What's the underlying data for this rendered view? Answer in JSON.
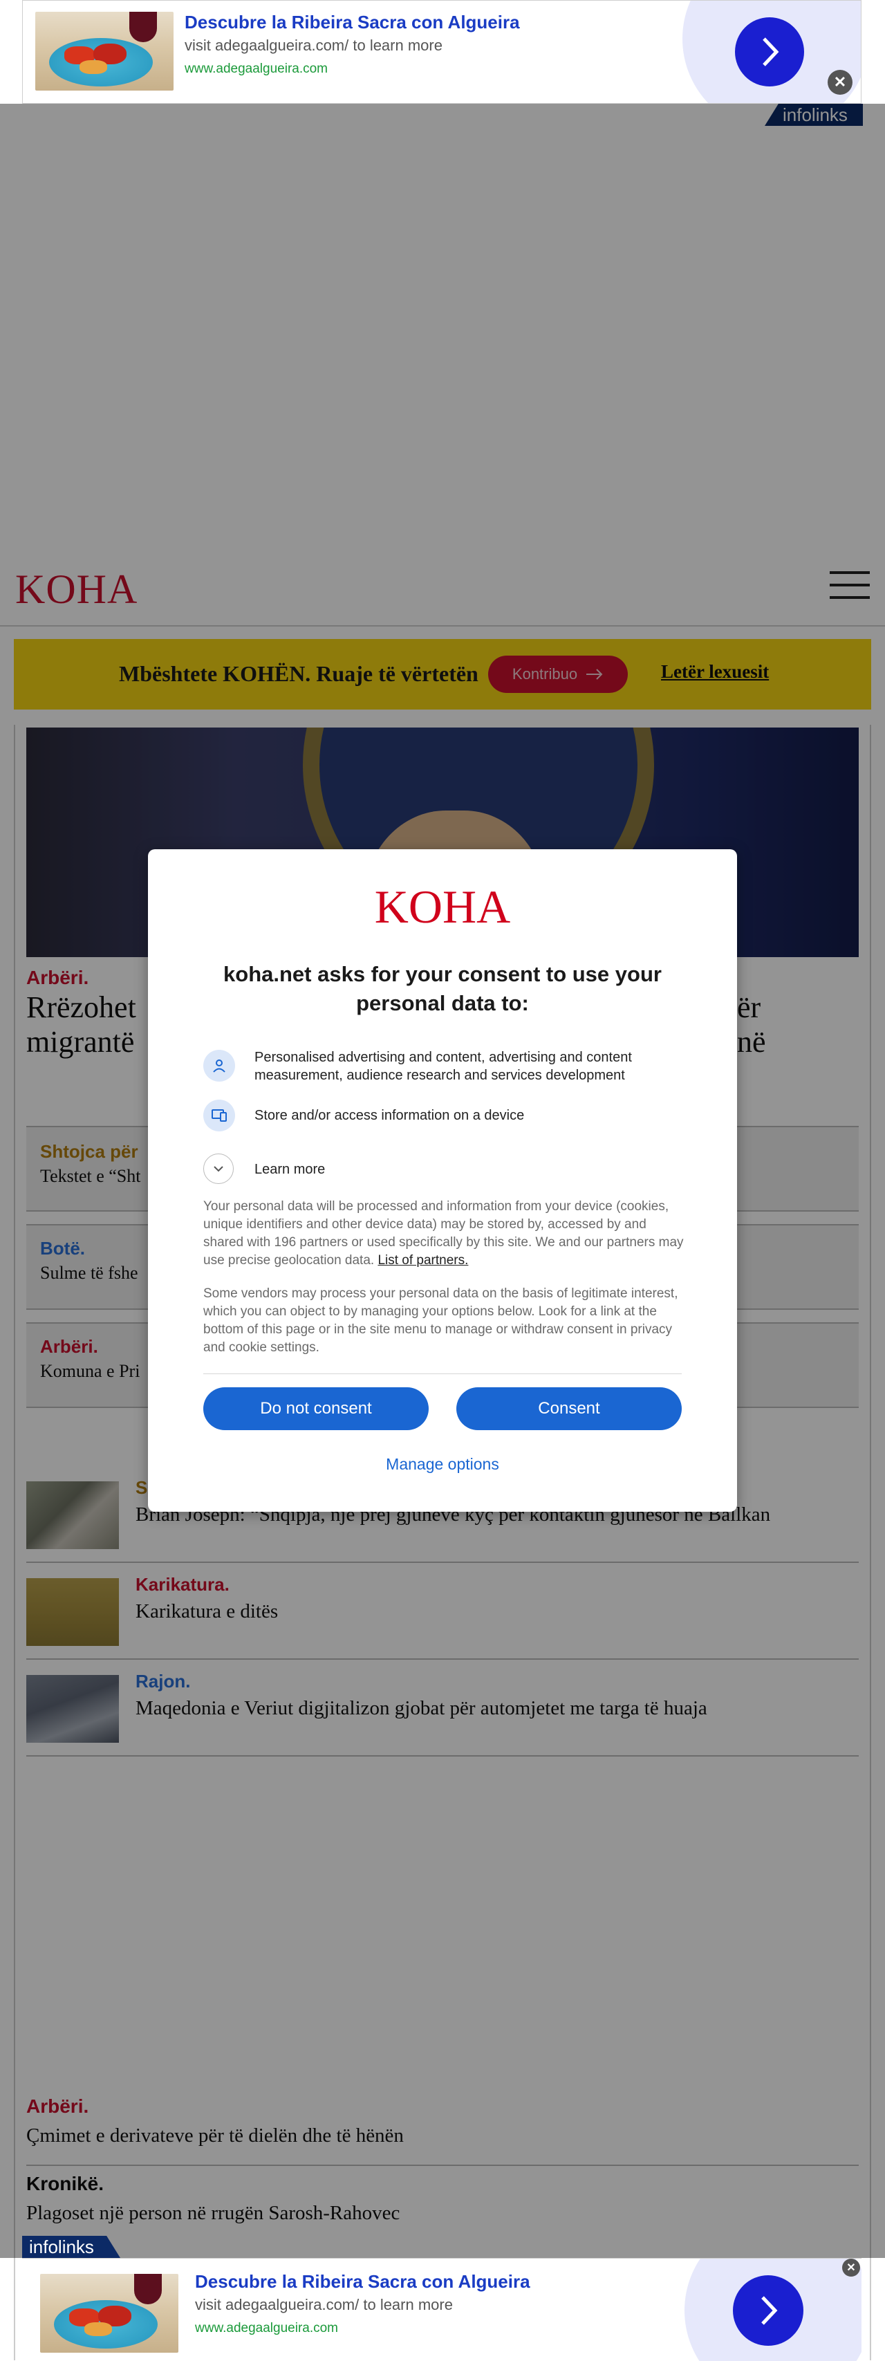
{
  "ad_top": {
    "title": "Descubre la Ribeira Sacra con Algueira",
    "subtitle": "visit adegaalgueira.com/ to learn more",
    "url": "www.adegaalgueira.com",
    "brand": "infolinks"
  },
  "header": {
    "logo": "KOHA"
  },
  "support_banner": {
    "text": "Mbështete KOHËN. Ruaje të vërtetën",
    "contribute_button": "Kontribuo",
    "reader_letter_link": "Letër lexuesit"
  },
  "hero": {
    "kicker": "Arbëri.",
    "headline_line1_start": "Rrëzohet",
    "headline_line1_end": "ër",
    "headline_line2_start": "migrantë",
    "headline_line2_end": "në"
  },
  "gray_cards": [
    {
      "kicker": "Shtojca për",
      "text": "Tekstet e “Sht"
    },
    {
      "kicker": "Botë.",
      "text": "Sulme të fshe"
    },
    {
      "kicker": "Arbëri.",
      "text": "Komuna e Pri"
    }
  ],
  "list_items": [
    {
      "kicker": "S",
      "title": "Brian Joseph: “Shqipja, një prej gjuhëve kyç për kontaktin gjuhësor në Ballkan"
    },
    {
      "kicker": "Karikatura.",
      "title": "Karikatura e ditës"
    },
    {
      "kicker": "Rajon.",
      "title": "Maqedonia e Veriut digjitalizon gjobat për automjetet me targa të huaja"
    }
  ],
  "bottom_items": [
    {
      "kicker": "Arbëri.",
      "title": "Çmimet e derivateve për të dielën dhe të hënën"
    },
    {
      "kicker": "Kronikë.",
      "title": "Plagoset një person në rrugën Sarosh-Rahovec"
    }
  ],
  "consent": {
    "logo": "KOHA",
    "heading": "koha.net asks for your consent to use your personal data to:",
    "purposes": [
      {
        "icon": "person-icon",
        "text": "Personalised advertising and content, advertising and content measurement, audience research and services development"
      },
      {
        "icon": "devices-icon",
        "text": "Store and/or access information on a device"
      }
    ],
    "learn_more": "Learn more",
    "paragraph1": "Your personal data will be processed and information from your device (cookies, unique identifiers and other device data) may be stored by, accessed by and shared with 196 partners or used specifically by this site. We and our partners may use precise geolocation data.",
    "partners_link": "List of partners.",
    "paragraph2": "Some vendors may process your personal data on the basis of legitimate interest, which you can object to by managing your options below. Look for a link at the bottom of this page or in the site menu to manage or withdraw consent in privacy and cookie settings.",
    "do_not_consent": "Do not consent",
    "consent_button": "Consent",
    "manage_options": "Manage options"
  },
  "ad_bottom": {
    "title": "Descubre la Ribeira Sacra con Algueira",
    "subtitle": "visit adegaalgueira.com/ to learn more",
    "url": "www.adegaalgueira.com",
    "brand": "infolinks"
  },
  "colors": {
    "brand_red": "#c8102e",
    "banner_yellow": "#f5d414",
    "consent_blue": "#1a66d2",
    "ad_arrow_blue": "#1a1fd0"
  }
}
